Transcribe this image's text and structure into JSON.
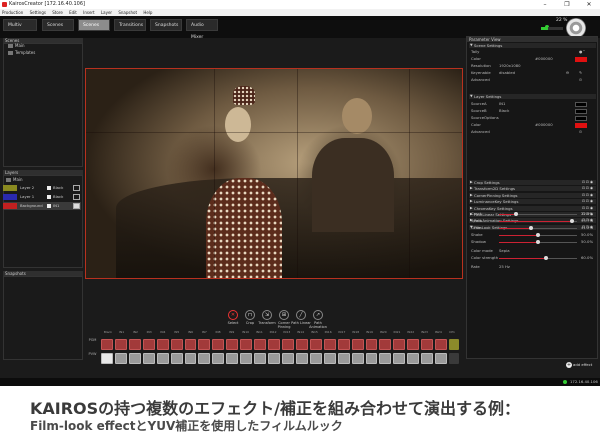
{
  "window": {
    "title": "KairosCreator [172.16.40.106]",
    "buttons": [
      "–",
      "❐",
      "✕"
    ]
  },
  "menu": [
    "Production",
    "Settings",
    "Store",
    "Edit",
    "Insert",
    "Layer",
    "Snapshot",
    "Help"
  ],
  "mode_tabs": [
    {
      "label": "Multiv",
      "selected": false
    },
    {
      "label": "Scenes",
      "selected": false
    },
    {
      "label": "Scenes",
      "selected": true
    },
    {
      "label": "Transitions",
      "selected": false
    },
    {
      "label": "Snapshots",
      "selected": false
    },
    {
      "label": "Audio Mixer",
      "selected": false
    }
  ],
  "top_right": {
    "percent": "22 %",
    "meter_level": 0.3
  },
  "scenes_panel": {
    "title": "Scenes",
    "items": [
      "Main",
      "Templates"
    ]
  },
  "layers_panel": {
    "title": "Layers",
    "root": "Main",
    "rows": [
      {
        "name": "Layer 2",
        "swatch": "#8a8a20",
        "source": "Black"
      },
      {
        "name": "Layer 1",
        "swatch": "#2a2ab0",
        "source": "Black"
      },
      {
        "name": "Background",
        "swatch": "#c02020",
        "source": "IN1"
      }
    ]
  },
  "snapshots_panel": {
    "title": "Snapshots"
  },
  "tools": [
    {
      "name": "Select",
      "icon": "✕",
      "red": true
    },
    {
      "name": "Crop",
      "icon": "⊓",
      "red": false
    },
    {
      "name": "Transform",
      "icon": "⇲",
      "red": false
    },
    {
      "name": "Corner Pinning",
      "icon": "⊞",
      "red": false
    },
    {
      "name": "Path Linear",
      "icon": "╱",
      "red": false
    },
    {
      "name": "Path Animation",
      "icon": "↗",
      "red": false
    }
  ],
  "bus_grid": {
    "headers": [
      "Black",
      "IN1",
      "IN2",
      "IN3",
      "IN4",
      "IN5",
      "IN6",
      "IN7",
      "IN8",
      "IN9",
      "IN10",
      "IN11",
      "IN12",
      "IN13",
      "IN14",
      "IN15",
      "IN16",
      "IN17",
      "IN18",
      "IN19",
      "IN20",
      "IN21",
      "IN22",
      "IN23",
      "IN24",
      "CP1"
    ],
    "pgm_label": "PGM",
    "pvw_label": "PVW"
  },
  "parameters": {
    "title": "Parameter View",
    "scene_settings": {
      "header": "Scene Settings",
      "tally": "Tally",
      "color_label": "Color",
      "color_value": "#000000",
      "color": "#e01010",
      "resolution_label": "Resolution",
      "resolution_value": "1920x1080",
      "keyenable_label": "Keyenable",
      "keyenable_value": "disabled",
      "advanced_label": "Advanced"
    },
    "layer_settings": {
      "header": "Layer Settings",
      "sourcea_label": "SourceA",
      "sourcea_value": "IN1",
      "sourceb_label": "SourceB",
      "sourceb_value": "Black",
      "sourceoptions_label": "SourceOptions",
      "color_label": "Color",
      "color_value": "#000000",
      "advanced_label": "Advanced"
    },
    "sections": [
      "Crop Settings",
      "Transform2D Settings",
      "CornerPinning Settings",
      "LuminanceKey Settings",
      "ChromaKey Settings",
      "PathLinear Settings",
      "PathAnimation Settings",
      "FilmLook Settings"
    ],
    "filmlook": [
      {
        "label": "Crack",
        "value": "22.0%",
        "level": 0.22
      },
      {
        "label": "Spots",
        "value": "93.7%",
        "level": 0.937
      },
      {
        "label": "Grain",
        "value": "41.2%",
        "level": 0.412
      },
      {
        "label": "Shake",
        "value": "50.0%",
        "level": 0.5
      },
      {
        "label": "Shadow",
        "value": "50.0%",
        "level": 0.5
      }
    ],
    "color_mode_label": "Color mode",
    "color_mode_value": "Sepia",
    "color_strength_label": "Color strength",
    "color_strength_value": "60.0%",
    "color_strength_level": 0.6,
    "rate_label": "Rate",
    "rate_value": "25 Hz"
  },
  "add_effect": "add effect",
  "status": {
    "ip": "172.16.40.106"
  },
  "caption": {
    "line1": "KAIROSの持つ複数のエフェクト/補正を組み合わせて演出する例：",
    "line2": "Film-look effectとYUV補正を使用したフィルムルック"
  }
}
